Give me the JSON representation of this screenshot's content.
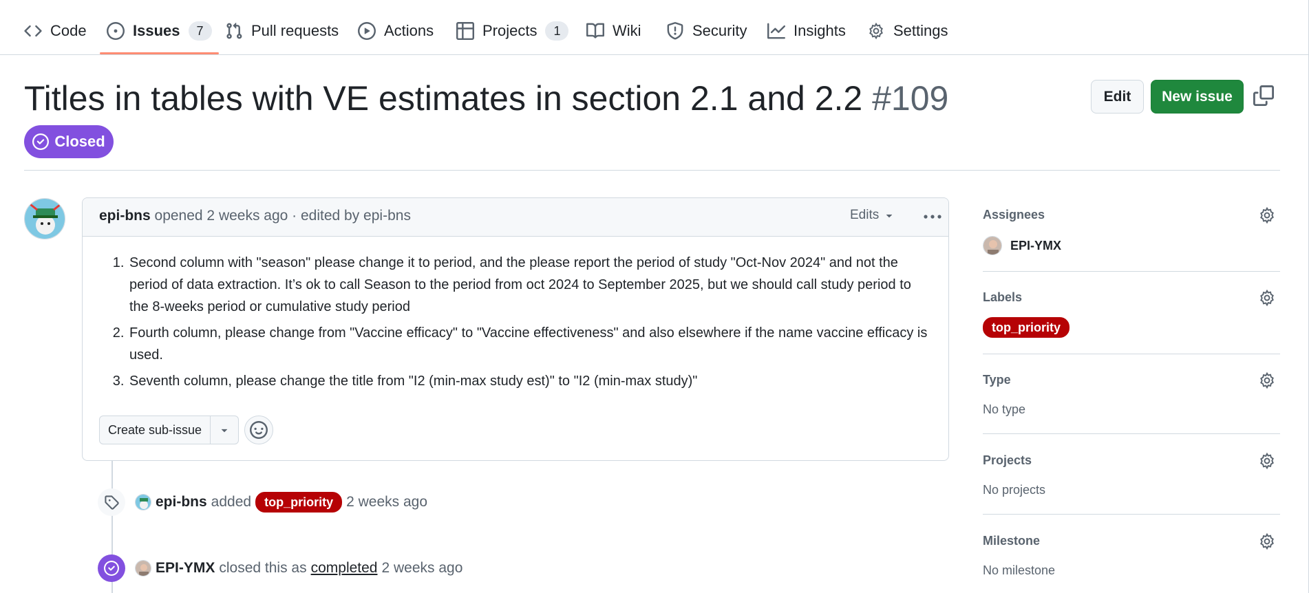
{
  "nav": {
    "tabs": [
      {
        "label": "Code",
        "icon": "code-icon"
      },
      {
        "label": "Issues",
        "icon": "issue-opened-icon",
        "count": "7",
        "selected": true
      },
      {
        "label": "Pull requests",
        "icon": "git-pull-request-icon"
      },
      {
        "label": "Actions",
        "icon": "play-icon"
      },
      {
        "label": "Projects",
        "icon": "table-icon",
        "count": "1"
      },
      {
        "label": "Wiki",
        "icon": "book-icon"
      },
      {
        "label": "Security",
        "icon": "shield-icon"
      },
      {
        "label": "Insights",
        "icon": "graph-icon"
      },
      {
        "label": "Settings",
        "icon": "gear-icon"
      }
    ],
    "selected_underline_color": "#fd8c73"
  },
  "issue": {
    "title": "Titles in tables with VE estimates in section 2.1 and 2.2",
    "number": "#109",
    "state": "Closed",
    "state_color": "#8250df",
    "edit_label": "Edit",
    "new_issue_label": "New issue",
    "new_issue_color": "#1f883d"
  },
  "comment": {
    "author": "epi-bns",
    "meta": "opened 2 weeks ago · edited by epi-bns",
    "edits_label": "Edits",
    "items": [
      "Second column with \"season\" please change it to period, and the please report the period of study \"Oct-Nov 2024\" and not the period of data extraction. It’s ok to call Season to the period from oct 2024 to September 2025, but we should call study period to the 8-weeks period or cumulative study period",
      "Fourth column, please change from \"Vaccine efficacy\" to \"Vaccine effectiveness\" and also elsewhere if the name vaccine efficacy is used.",
      "Seventh column, please change the title from \"I2 (min-max study est)\" to \"I2 (min-max study)\""
    ],
    "create_subissue_label": "Create sub-issue"
  },
  "events": {
    "labeled": {
      "author": "epi-bns",
      "action": "added",
      "label": "top_priority",
      "label_color": "#b60205",
      "time": "2 weeks ago"
    },
    "closed": {
      "author": "EPI-YMX",
      "action": "closed this as",
      "reason": "completed",
      "time": "2 weeks ago"
    }
  },
  "sidebar": {
    "assignees": {
      "heading": "Assignees",
      "value": "EPI-YMX"
    },
    "labels": {
      "heading": "Labels",
      "value": "top_priority"
    },
    "type": {
      "heading": "Type",
      "value": "No type"
    },
    "projects": {
      "heading": "Projects",
      "value": "No projects"
    },
    "milestone": {
      "heading": "Milestone",
      "value": "No milestone"
    }
  }
}
